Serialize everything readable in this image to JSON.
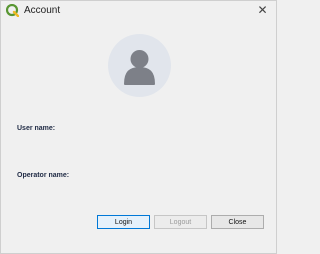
{
  "window": {
    "title": "Account",
    "close_glyph": "✕",
    "app_icon": "qgis-icon"
  },
  "avatar": {
    "icon": "user-silhouette-icon",
    "background_color": "#e1e5ec",
    "figure_color": "#7d8088"
  },
  "fields": {
    "user_name_label": "User name:",
    "operator_name_label": "Operator name:"
  },
  "buttons": {
    "login": "Login",
    "logout": "Logout",
    "close": "Close"
  },
  "colors": {
    "accent": "#0078d7",
    "qgis_green": "#589632",
    "qgis_yellow": "#ee7913"
  }
}
